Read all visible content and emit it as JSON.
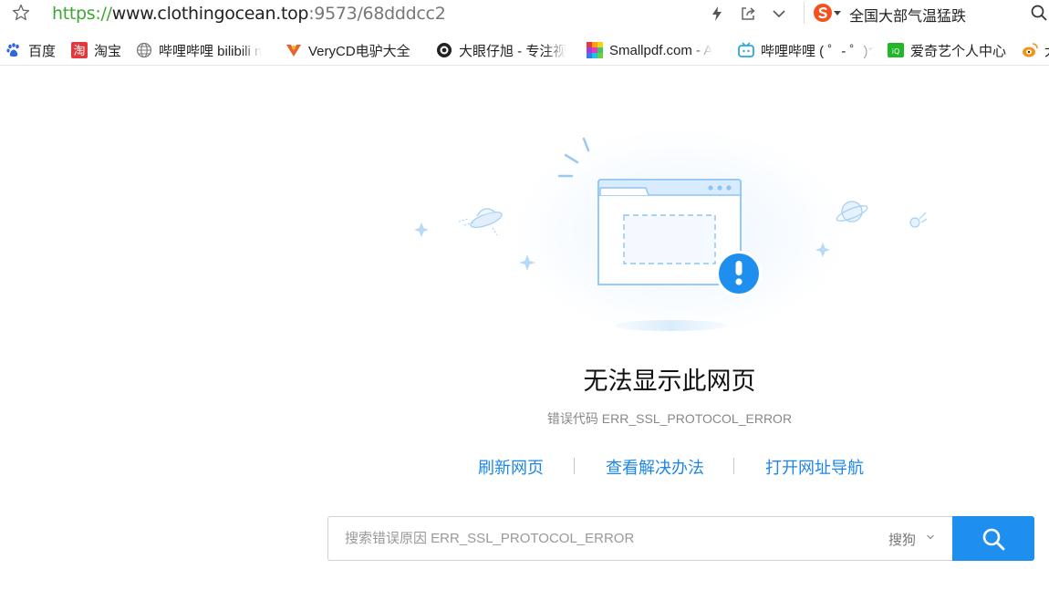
{
  "address_bar": {
    "url_scheme": "https://",
    "url_host": "www.clothingocean.top",
    "url_rest": ":9573/68dddcc2",
    "hot_news": "全国大部气温猛跌"
  },
  "bookmarks": [
    {
      "label": "百度",
      "icon": "baidu-paw-icon"
    },
    {
      "label": "淘宝",
      "icon": "taobao-icon"
    },
    {
      "label": "哔哩哔哩 bilibili n",
      "icon": "globe-icon"
    },
    {
      "label": "VeryCD电驴大全",
      "icon": "verycd-icon"
    },
    {
      "label": "大眼仔旭 - 专注视",
      "icon": "eye-icon"
    },
    {
      "label": "Smallpdf.com - A",
      "icon": "smallpdf-icon"
    },
    {
      "label": "哔哩哔哩 ( ゜- ゜)つ",
      "icon": "bilibili-tv-icon"
    },
    {
      "label": "爱奇艺个人中心",
      "icon": "iqiyi-icon"
    },
    {
      "label": "大",
      "icon": "weibo-icon"
    }
  ],
  "error": {
    "title": "无法显示此网页",
    "code_line": "错误代码 ERR_SSL_PROTOCOL_ERROR"
  },
  "actions": {
    "refresh": "刷新网页",
    "solutions": "查看解决办法",
    "open_nav": "打开网址导航"
  },
  "search": {
    "placeholder": "搜索错误原因 ERR_SSL_PROTOCOL_ERROR",
    "engine": "搜狗"
  },
  "colors": {
    "accent": "#1e8fef",
    "link": "#1e87e5",
    "url_scheme": "#3fa535"
  }
}
